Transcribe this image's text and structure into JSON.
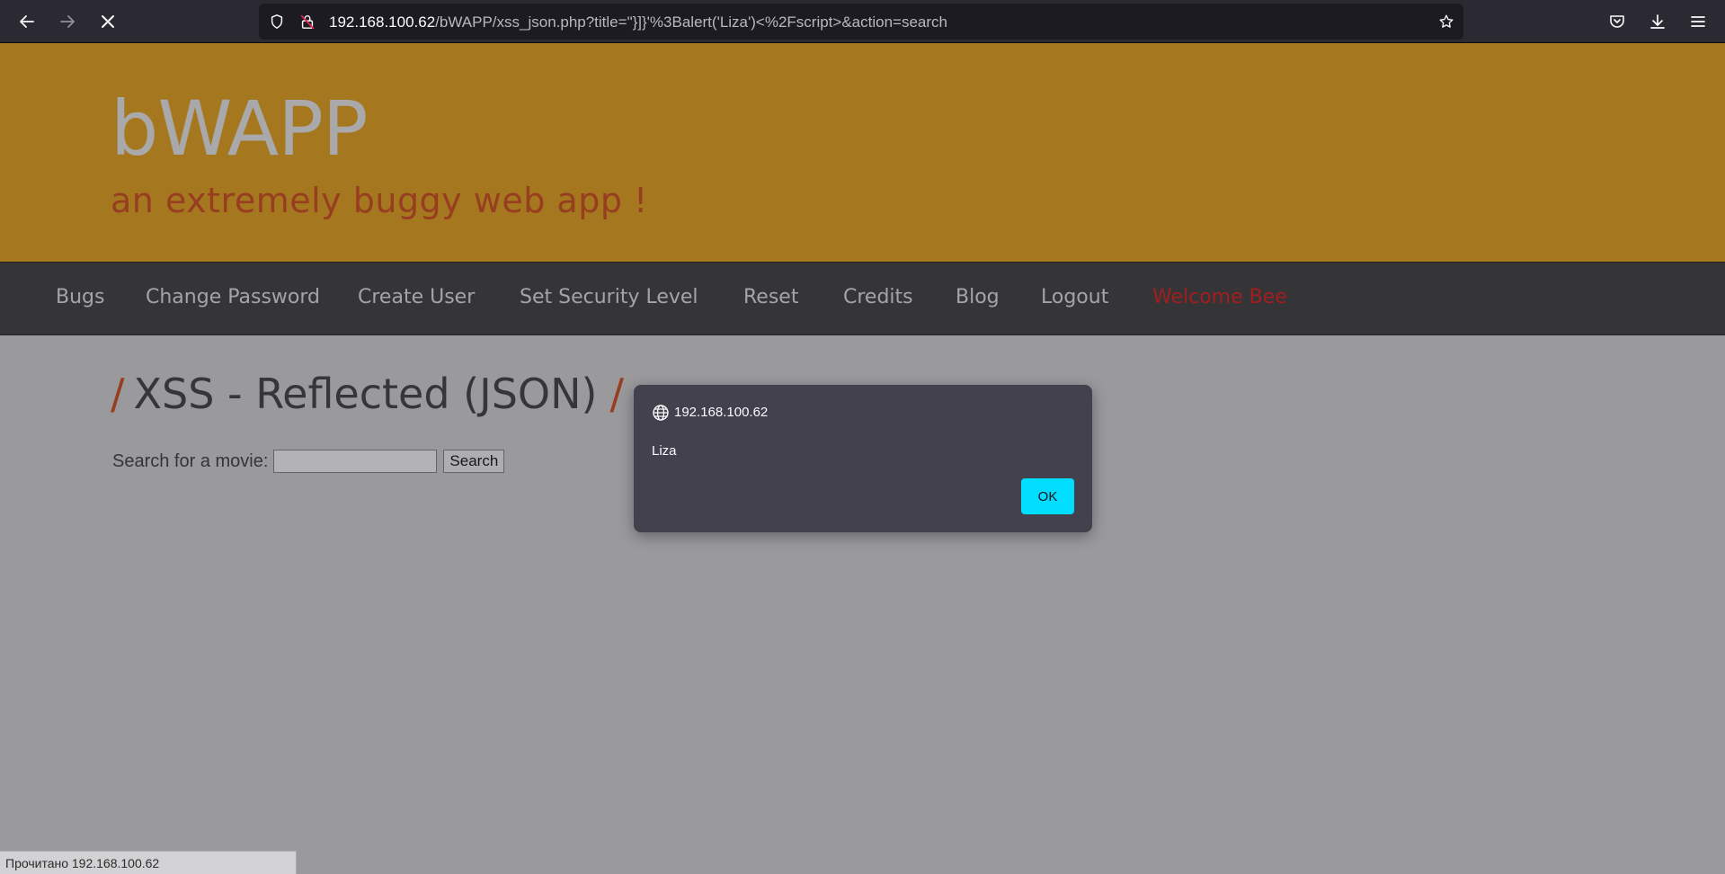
{
  "browser": {
    "url_host": "192.168.100.62",
    "url_path": "/bWAPP/xss_json.php?title=\"}]}'%3Balert('Liza')<%2Fscript>&action=search",
    "icons": [
      "back-icon",
      "forward-icon",
      "stop-icon",
      "shield-icon",
      "insecure-lock-icon",
      "bookmark-star-icon",
      "pocket-icon",
      "downloads-icon",
      "menu-icon"
    ]
  },
  "site": {
    "logo": "bWAPP",
    "tagline": "an extremely buggy web app !",
    "colors": {
      "header": "#d4951a",
      "accent": "#c0461c",
      "menubar": "#3a3a3a"
    }
  },
  "menu": {
    "items": [
      {
        "label": "Bugs"
      },
      {
        "label": "Change Password"
      },
      {
        "label": "Create User"
      },
      {
        "label": "Set Security Level"
      },
      {
        "label": "Reset"
      },
      {
        "label": "Credits"
      },
      {
        "label": "Blog"
      },
      {
        "label": "Logout"
      },
      {
        "label": "Welcome Bee"
      }
    ]
  },
  "main": {
    "slash": "/",
    "title": "XSS - Reflected (JSON)",
    "slash_end": "/",
    "search_label": "Search for a movie:",
    "search_value": "",
    "search_button": "Search"
  },
  "dialog": {
    "host": "192.168.100.62",
    "message": "Liza",
    "ok_label": "OK"
  },
  "status": {
    "text": "Прочитано 192.168.100.62"
  }
}
